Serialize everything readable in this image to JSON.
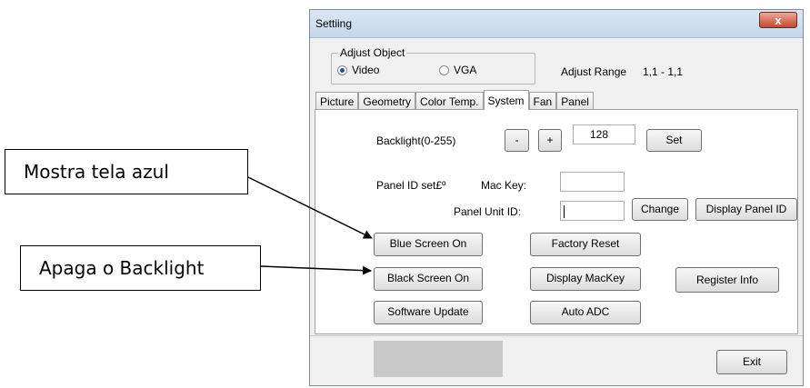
{
  "callouts": {
    "blue_screen_note": "Mostra tela azul",
    "backlight_note": "Apaga o Backlight"
  },
  "window": {
    "title": "Settiing",
    "close_glyph": "x"
  },
  "adjust_object": {
    "group_label": "Adjust Object",
    "options": [
      {
        "label": "Video",
        "selected": true
      },
      {
        "label": "VGA",
        "selected": false
      }
    ],
    "range_label": "Adjust Range",
    "range_value": "1,1 - 1,1"
  },
  "tabs": [
    {
      "label": "Picture",
      "active": false
    },
    {
      "label": "Geometry",
      "active": false
    },
    {
      "label": "Color Temp.",
      "active": false
    },
    {
      "label": "System",
      "active": true
    },
    {
      "label": "Fan",
      "active": false
    },
    {
      "label": "Panel",
      "active": false
    }
  ],
  "system": {
    "backlight_label": "Backlight(0-255)",
    "minus_label": "-",
    "plus_label": "+",
    "backlight_value": "128",
    "set_label": "Set",
    "panel_id_label": "Panel ID set£º",
    "mac_key_label": "Mac Key:",
    "panel_unit_label": "Panel Unit ID:",
    "change_label": "Change",
    "display_panel_id_label": "Display Panel ID",
    "blue_screen_label": "Blue Screen On",
    "factory_reset_label": "Factory Reset",
    "black_screen_label": "Black Screen On",
    "display_mackey_label": "Display MacKey",
    "register_info_label": "Register Info",
    "software_update_label": "Software Update",
    "auto_adc_label": "Auto ADC"
  },
  "footer": {
    "exit_label": "Exit"
  }
}
